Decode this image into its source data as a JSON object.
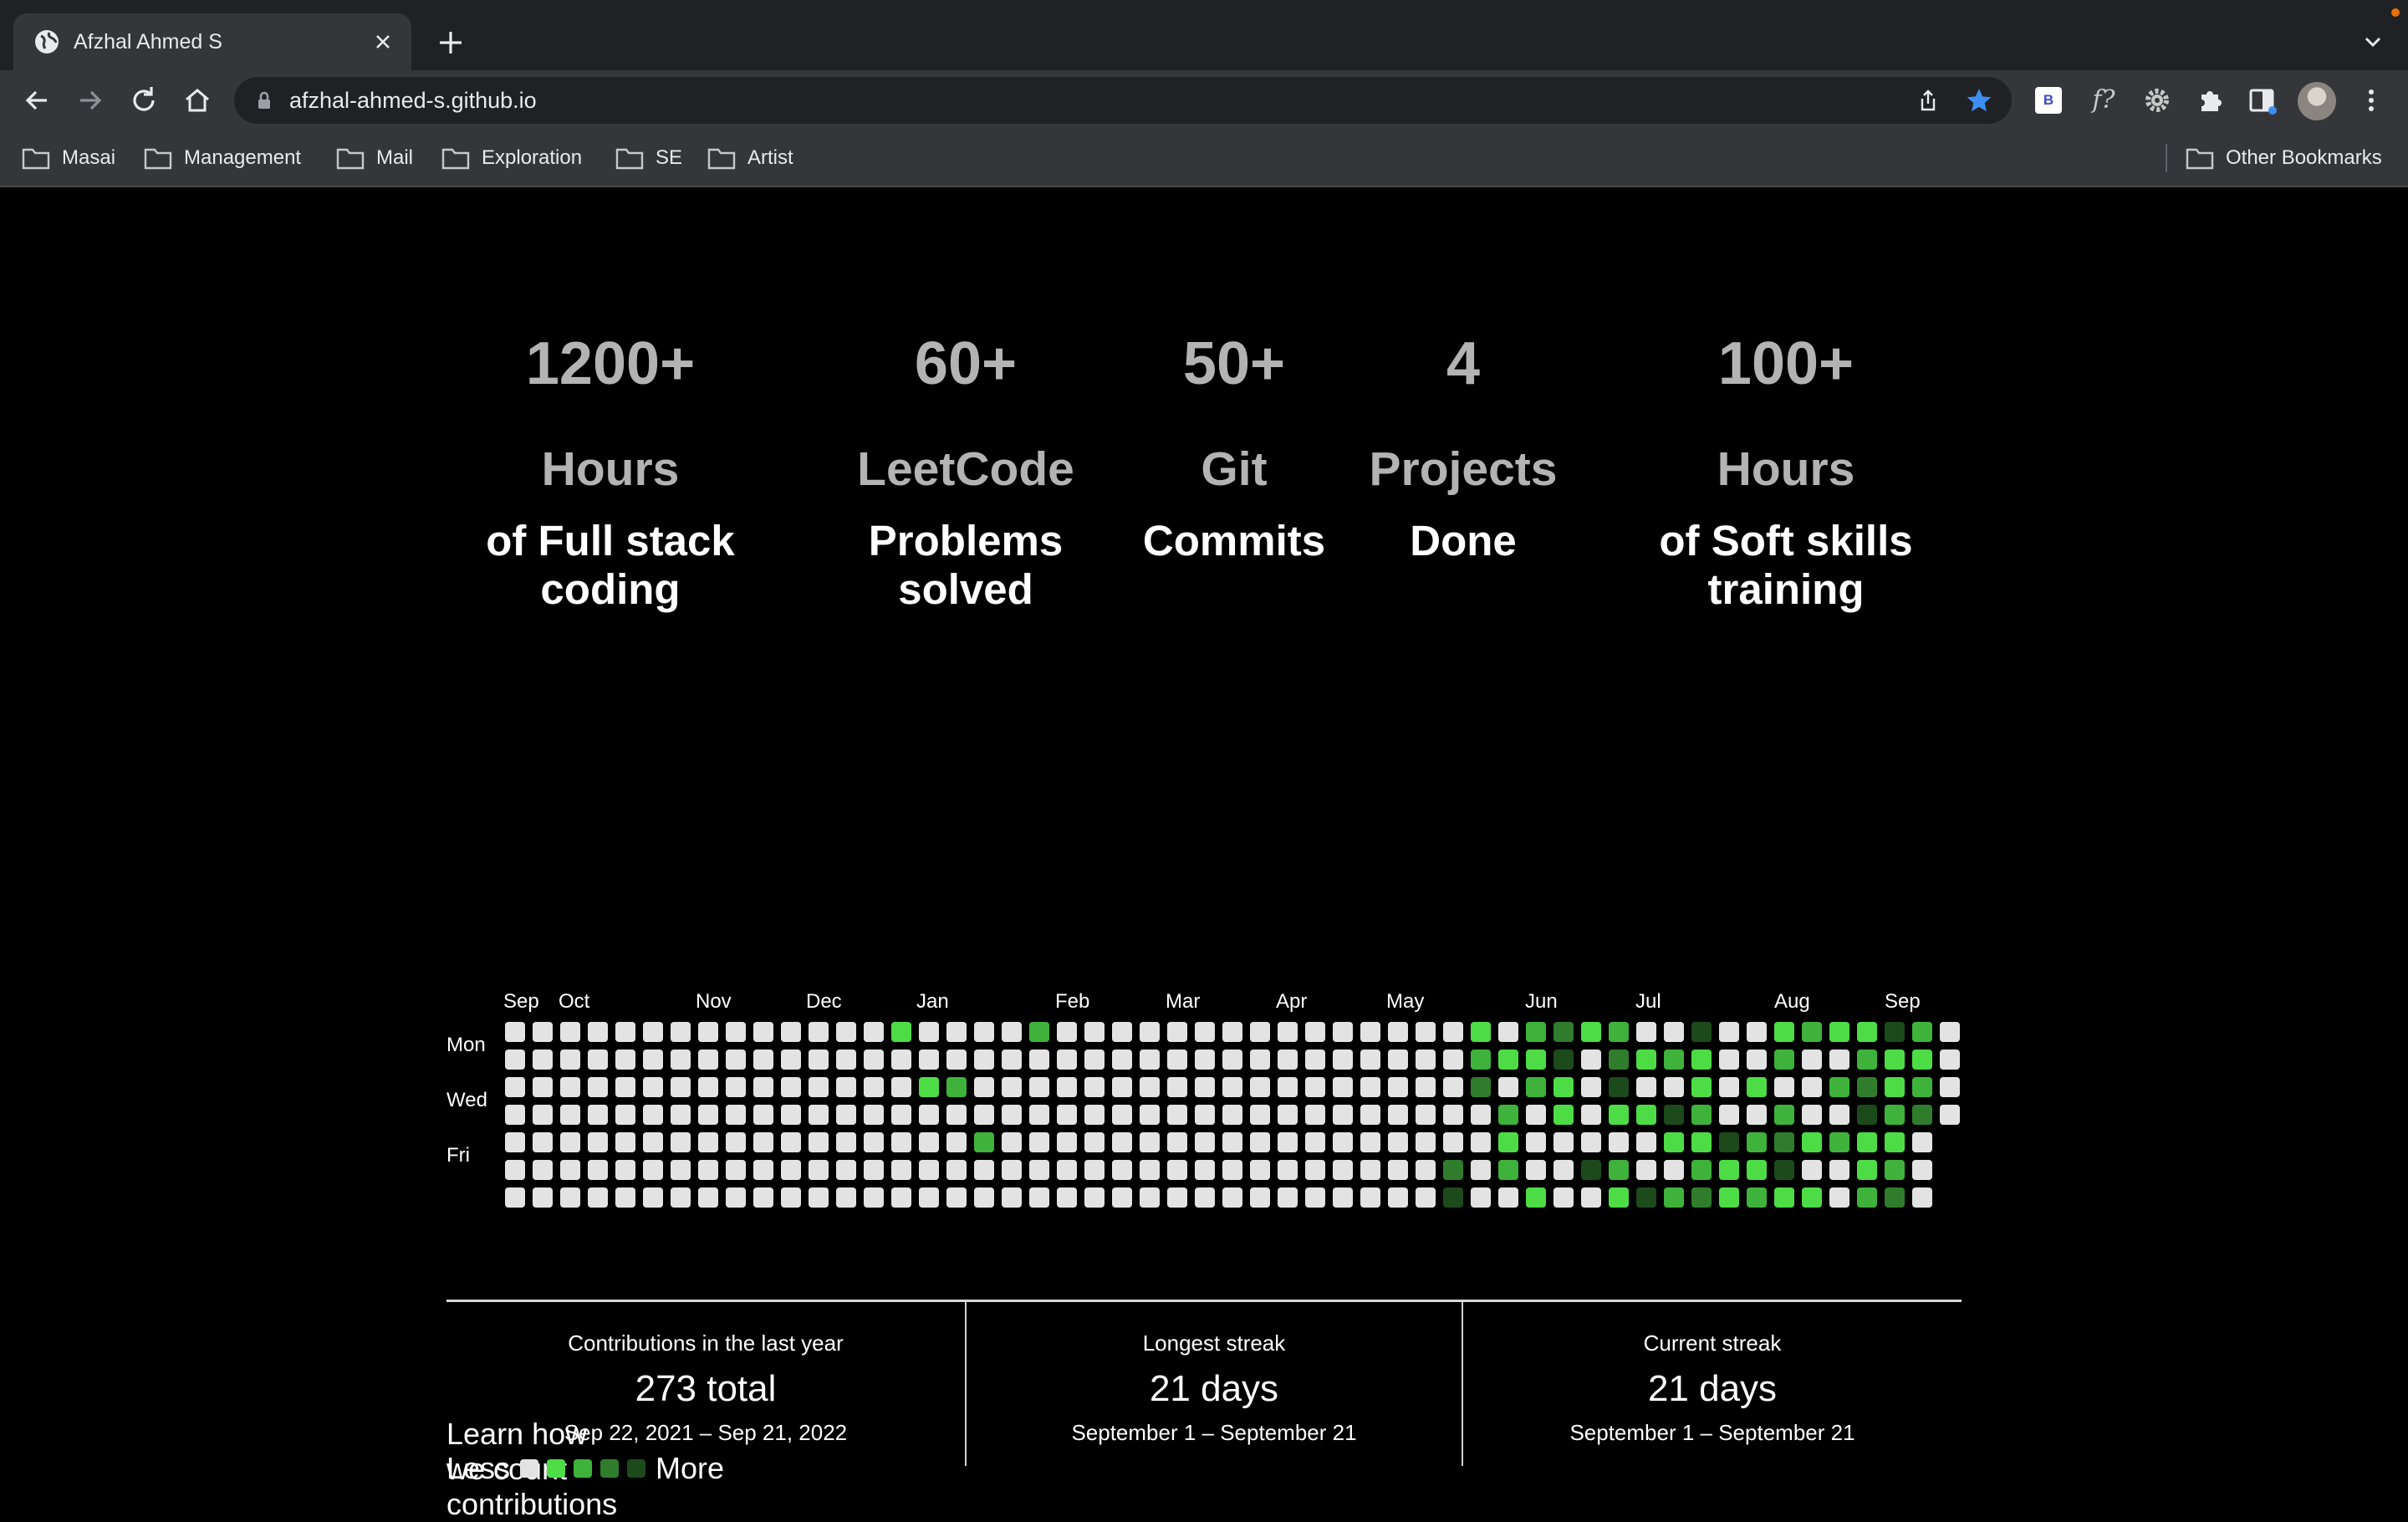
{
  "browser": {
    "tab_title": "Afzhal Ahmed S",
    "url": "afzhal-ahmed-s.github.io",
    "extension_b_label": "B",
    "extension_f_label": "f?",
    "bookmarks": [
      "Masai",
      "Management",
      "Mail",
      "Exploration",
      "SE",
      "Artist"
    ],
    "other_bookmarks": "Other Bookmarks"
  },
  "stats": [
    {
      "number": "1200+",
      "unit": "Hours",
      "desc": "of Full stack coding"
    },
    {
      "number": "60+",
      "unit": "LeetCode",
      "desc": "Problems solved"
    },
    {
      "number": "50+",
      "unit": "Git",
      "desc": "Commits"
    },
    {
      "number": "4",
      "unit": "Projects",
      "desc": "Done"
    },
    {
      "number": "100+",
      "unit": "Hours",
      "desc": "of Soft skills training"
    }
  ],
  "calendar": {
    "months": [
      "Sep",
      "Oct",
      "Nov",
      "Dec",
      "Jan",
      "Feb",
      "Mar",
      "Apr",
      "May",
      "Jun",
      "Jul",
      "Aug",
      "Sep"
    ],
    "weekday_labels": [
      "Mon",
      "Wed",
      "Fri"
    ],
    "level_colors": [
      "#e3e3e3",
      "#4ddc46",
      "#3eb23a",
      "#2f7d2c",
      "#1c4a1b"
    ],
    "active_days": {
      "14": [
        0
      ],
      "15": [
        2
      ],
      "16": [
        2
      ],
      "17": [
        4
      ],
      "19": [
        0
      ],
      "34": [
        5,
        6
      ],
      "35": [
        0,
        1,
        2
      ],
      "36": [
        1,
        3,
        4,
        5
      ],
      "37": [
        0,
        1,
        2,
        6
      ],
      "38": [
        0,
        1,
        2,
        3
      ],
      "39": [
        0,
        5
      ],
      "40": [
        0,
        1,
        2,
        3,
        5,
        6
      ],
      "41": [
        1,
        3,
        6
      ],
      "42": [
        1,
        3,
        4,
        6
      ],
      "43": [
        0,
        1,
        2,
        3,
        4,
        5,
        6
      ],
      "44": [
        4,
        5,
        6
      ],
      "45": [
        2,
        4,
        5,
        6
      ],
      "46": [
        0,
        1,
        3,
        4,
        5,
        6
      ],
      "47": [
        0,
        4,
        6
      ],
      "48": [
        0,
        2,
        4
      ],
      "49": [
        0,
        1,
        2,
        3,
        4,
        5,
        6
      ],
      "50": [
        0,
        1,
        2,
        3,
        4,
        5,
        6
      ],
      "51": [
        0,
        1,
        2,
        3
      ]
    },
    "learn_text": "Learn how we count contributions",
    "legend_less": "Less",
    "legend_more": "More"
  },
  "streaks": [
    {
      "label": "Contributions in the last year",
      "value": "273 total",
      "range": "Sep 22, 2021 – Sep 21, 2022"
    },
    {
      "label": "Longest streak",
      "value": "21 days",
      "range": "September 1 – September 21"
    },
    {
      "label": "Current streak",
      "value": "21 days",
      "range": "September 1 – September 21"
    }
  ]
}
